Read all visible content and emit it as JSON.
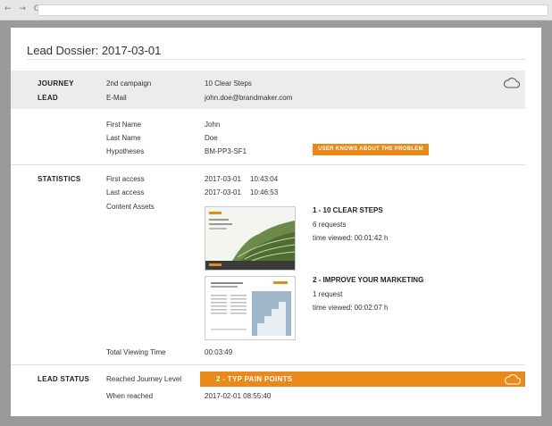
{
  "browser": {
    "nav": "← → C"
  },
  "page": {
    "title": "Lead Dossier: 2017-03-01"
  },
  "journey": {
    "label": "JOURNEY",
    "campaign": "2nd campaign",
    "value": "10 Clear Steps"
  },
  "lead": {
    "label": "LEAD",
    "email_label": "E-Mail",
    "email": "john.doe@brandmaker.com"
  },
  "person": {
    "first_name_label": "First Name",
    "first_name": "John",
    "last_name_label": "Last Name",
    "last_name": "Doe",
    "hypotheses_label": "Hypotheses",
    "hypotheses": "BM-PP3-SF1",
    "badge": "USER KNOWS ABOUT THE PROBLEM"
  },
  "statistics": {
    "label": "STATISTICS",
    "first_access_label": "First access",
    "first_access_date": "2017-03-01",
    "first_access_time": "10:43:04",
    "last_access_label": "Last access",
    "last_access_date": "2017-03-01",
    "last_access_time": "10:46:53",
    "content_assets_label": "Content Assets",
    "assets": [
      {
        "title": "1 - 10 CLEAR STEPS",
        "requests": "6 requests",
        "time": "time viewed: 00:01:42 h"
      },
      {
        "title": "2 - IMPROVE YOUR MARKETING",
        "requests": "1 request",
        "time": "time viewed: 00:02:07 h"
      }
    ],
    "total_label": "Total Viewing Time",
    "total": "00:03:49"
  },
  "lead_status": {
    "label": "LEAD STATUS",
    "reached_label": "Reached Journey Level",
    "reached": "2 - TYP PAIN POINTS",
    "when_label": "When reached",
    "when": "2017-02-01 08:55:40"
  },
  "colors": {
    "accent": "#e8891a",
    "band": "#ececec",
    "frame": "#9a9a9a"
  },
  "icons": {
    "cloud": "cloud-icon"
  }
}
